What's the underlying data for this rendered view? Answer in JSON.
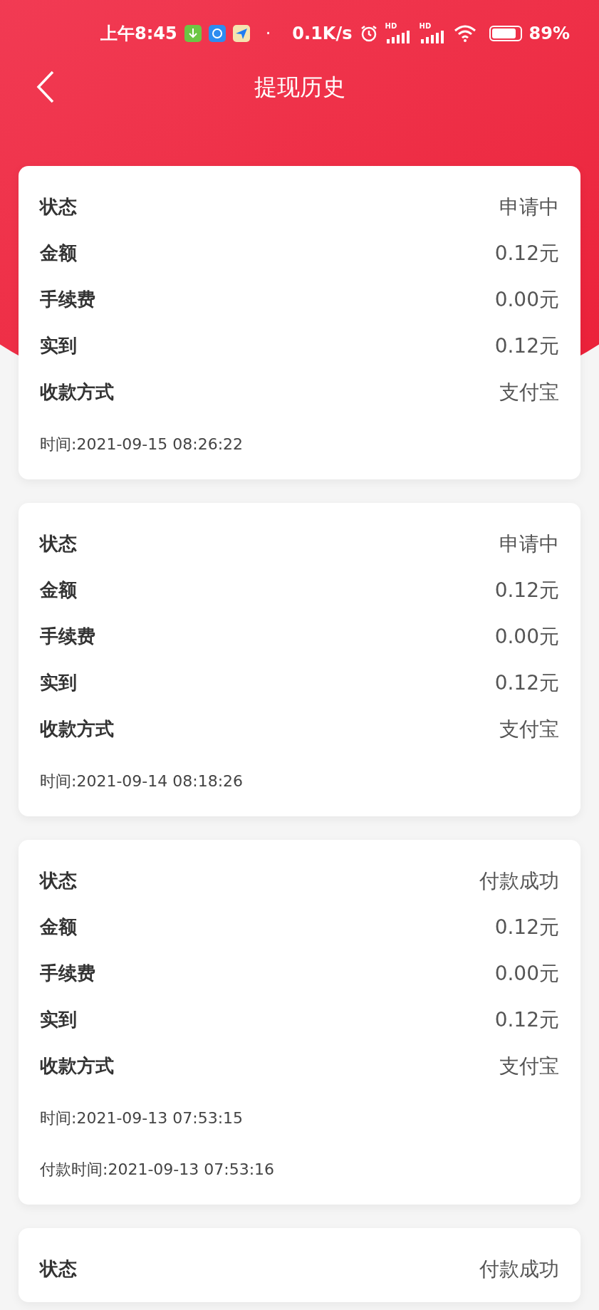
{
  "status_bar": {
    "time": "上午8:45",
    "dot": "·",
    "speed": "0.1K/s",
    "signal_labels": [
      "HD",
      "HD"
    ],
    "battery": "89%"
  },
  "nav": {
    "title": "提现历史"
  },
  "records": [
    {
      "fields": [
        {
          "label": "状态",
          "value": "申请中"
        },
        {
          "label": "金额",
          "value": "0.12元"
        },
        {
          "label": "手续费",
          "value": "0.00元"
        },
        {
          "label": "实到",
          "value": "0.12元"
        },
        {
          "label": "收款方式",
          "value": "支付宝"
        }
      ],
      "times": [
        "时间:2021-09-15 08:26:22"
      ]
    },
    {
      "fields": [
        {
          "label": "状态",
          "value": "申请中"
        },
        {
          "label": "金额",
          "value": "0.12元"
        },
        {
          "label": "手续费",
          "value": "0.00元"
        },
        {
          "label": "实到",
          "value": "0.12元"
        },
        {
          "label": "收款方式",
          "value": "支付宝"
        }
      ],
      "times": [
        "时间:2021-09-14 08:18:26"
      ]
    },
    {
      "fields": [
        {
          "label": "状态",
          "value": "付款成功"
        },
        {
          "label": "金额",
          "value": "0.12元"
        },
        {
          "label": "手续费",
          "value": "0.00元"
        },
        {
          "label": "实到",
          "value": "0.12元"
        },
        {
          "label": "收款方式",
          "value": "支付宝"
        }
      ],
      "times": [
        "时间:2021-09-13 07:53:15",
        "付款时间:2021-09-13 07:53:16"
      ]
    },
    {
      "fields": [
        {
          "label": "状态",
          "value": "付款成功"
        }
      ]
    }
  ]
}
